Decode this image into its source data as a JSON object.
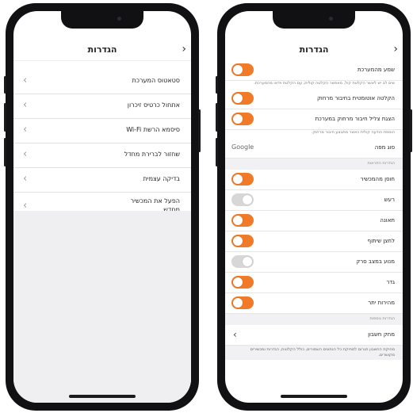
{
  "colors": {
    "accent": "#f07a28",
    "toggle_off": "#d7d7d7"
  },
  "left_screen": {
    "title": "הגדרות",
    "back_icon": "chevron-right-icon",
    "items": [
      {
        "label": "סטאטוס המערכת"
      },
      {
        "label": "אתחול כרטיס זיכרון"
      },
      {
        "label": "סיסמא הרשת Wi-Fi"
      },
      {
        "label": "שחזור לברירת מחדל"
      },
      {
        "label": "בדיקה עצמית"
      },
      {
        "label": "הפעל את המכשיר מחדש"
      }
    ]
  },
  "right_screen": {
    "title": "הגדרות",
    "rows": [
      {
        "label": "שמע מהמערכת",
        "toggle": "on",
        "desc": "שים לב יש לאשר הקלטת קול, מאפשר הקלטה קולית, עם הקלטת וידאו מהמערכת."
      },
      {
        "label": "הקלטה אוטומטית בחיבור מרחוק",
        "toggle": "on"
      },
      {
        "label": "הצגת צליל חיבור מרחוק במערכת",
        "toggle": "on",
        "desc": "הוספת הודעה קולית כאשר מתבצע חיבור מרחוק."
      },
      {
        "label": "סוג מפה",
        "value": "Google"
      }
    ],
    "section1_header": "הגדרות התראות",
    "alerts": [
      {
        "label": "חוסן מהמכשיר",
        "toggle": "on"
      },
      {
        "label": "רעש",
        "toggle": "off"
      },
      {
        "label": "תאונה",
        "toggle": "on"
      },
      {
        "label": "לחצן שיתוף",
        "toggle": "on"
      },
      {
        "label": "מנוע במצב סרק",
        "toggle": "off"
      },
      {
        "label": "גדר",
        "toggle": "on"
      },
      {
        "label": "מהירות יתר",
        "toggle": "on"
      }
    ],
    "section2_header": "הגדרות נוספות",
    "account_row": {
      "label": "מחק חשבון"
    },
    "footer_desc": "מחיקת החשבון תגרום למחיקת כל הנתונים השמורים, כולל הקלטות, הגדרות ומכשירים מקושרים."
  }
}
